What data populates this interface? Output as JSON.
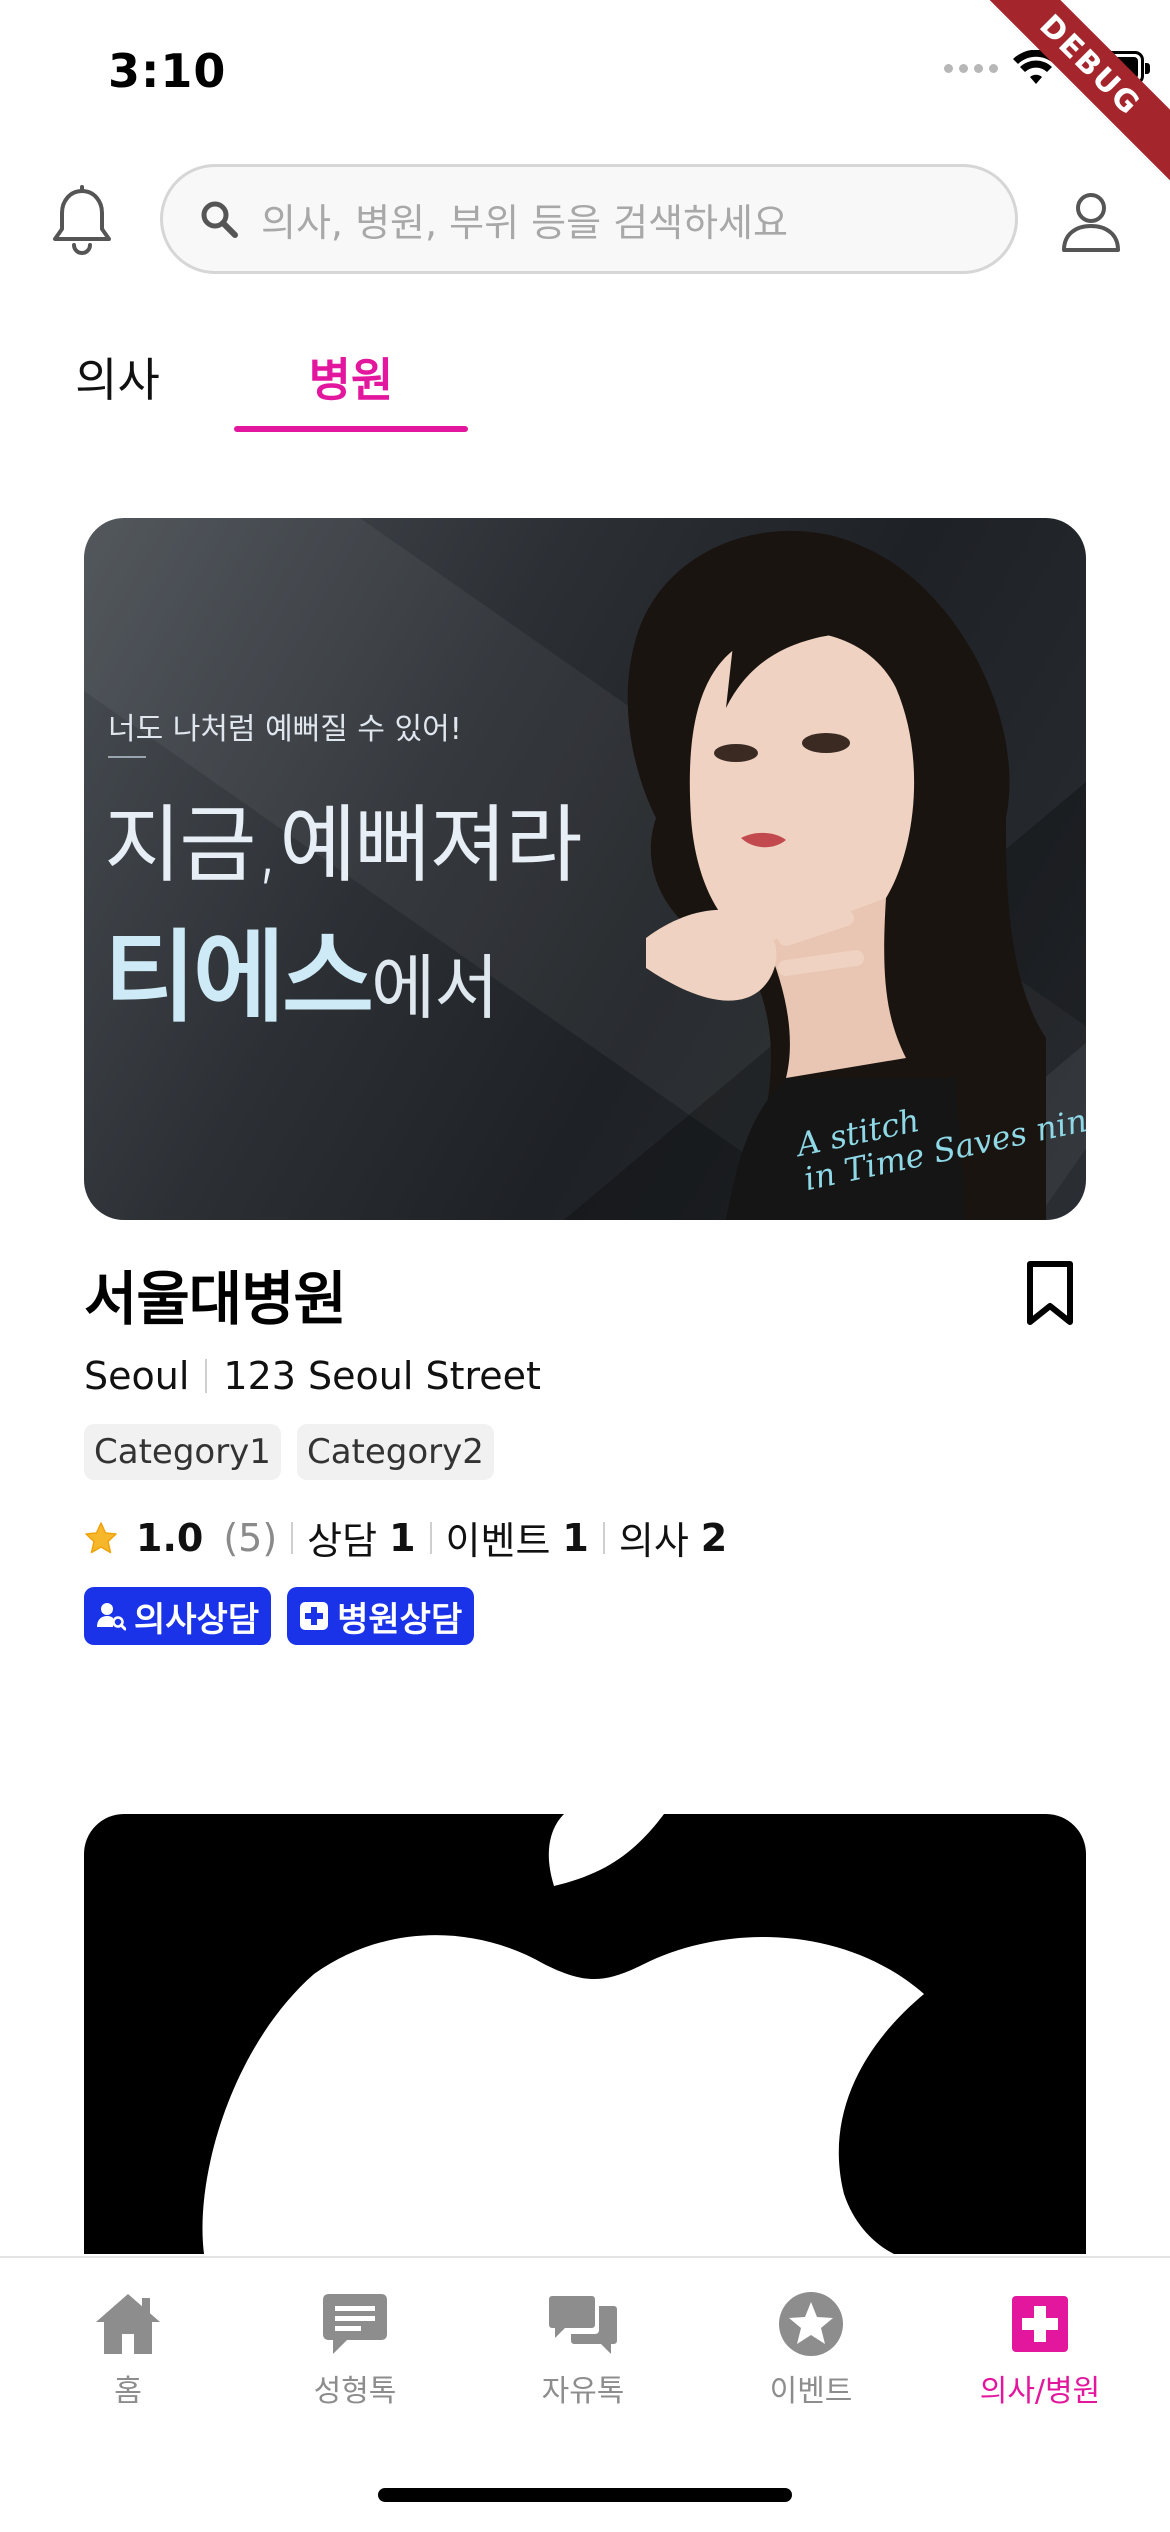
{
  "status_bar": {
    "time": "3:10",
    "debug_label": "DEBUG"
  },
  "header": {
    "search_placeholder": "의사, 병원, 부위 등을 검색하세요"
  },
  "tabs": [
    {
      "label": "의사",
      "active": false
    },
    {
      "label": "병원",
      "active": true
    }
  ],
  "hospital_card": {
    "banner": {
      "tagline": "너도 나처럼 예뻐질 수 있어!",
      "headline": "지금,예뻐져라",
      "brand": "티에스",
      "brand_suffix": "에서",
      "script_line1": "A stitch",
      "script_line2": "in Time Saves nin"
    },
    "name": "서울대병원",
    "city": "Seoul",
    "address": "123 Seoul Street",
    "categories": [
      "Category1",
      "Category2"
    ],
    "rating": "1.0",
    "review_count": "(5)",
    "stats": [
      {
        "label": "상담",
        "value": "1"
      },
      {
        "label": "이벤트",
        "value": "1"
      },
      {
        "label": "의사",
        "value": "2"
      }
    ],
    "consult_buttons": [
      "의사상담",
      "병원상담"
    ]
  },
  "bottom_nav": [
    {
      "label": "홈",
      "icon": "home-icon",
      "active": false
    },
    {
      "label": "성형톡",
      "icon": "chat-bubble-icon",
      "active": false
    },
    {
      "label": "자유톡",
      "icon": "forum-icon",
      "active": false
    },
    {
      "label": "이벤트",
      "icon": "star-circle-icon",
      "active": false
    },
    {
      "label": "의사/병원",
      "icon": "medical-cross-icon",
      "active": true
    }
  ],
  "colors": {
    "accent": "#e3179e",
    "consult_blue": "#1b33e8",
    "inactive_gray": "#8d8d8d"
  }
}
